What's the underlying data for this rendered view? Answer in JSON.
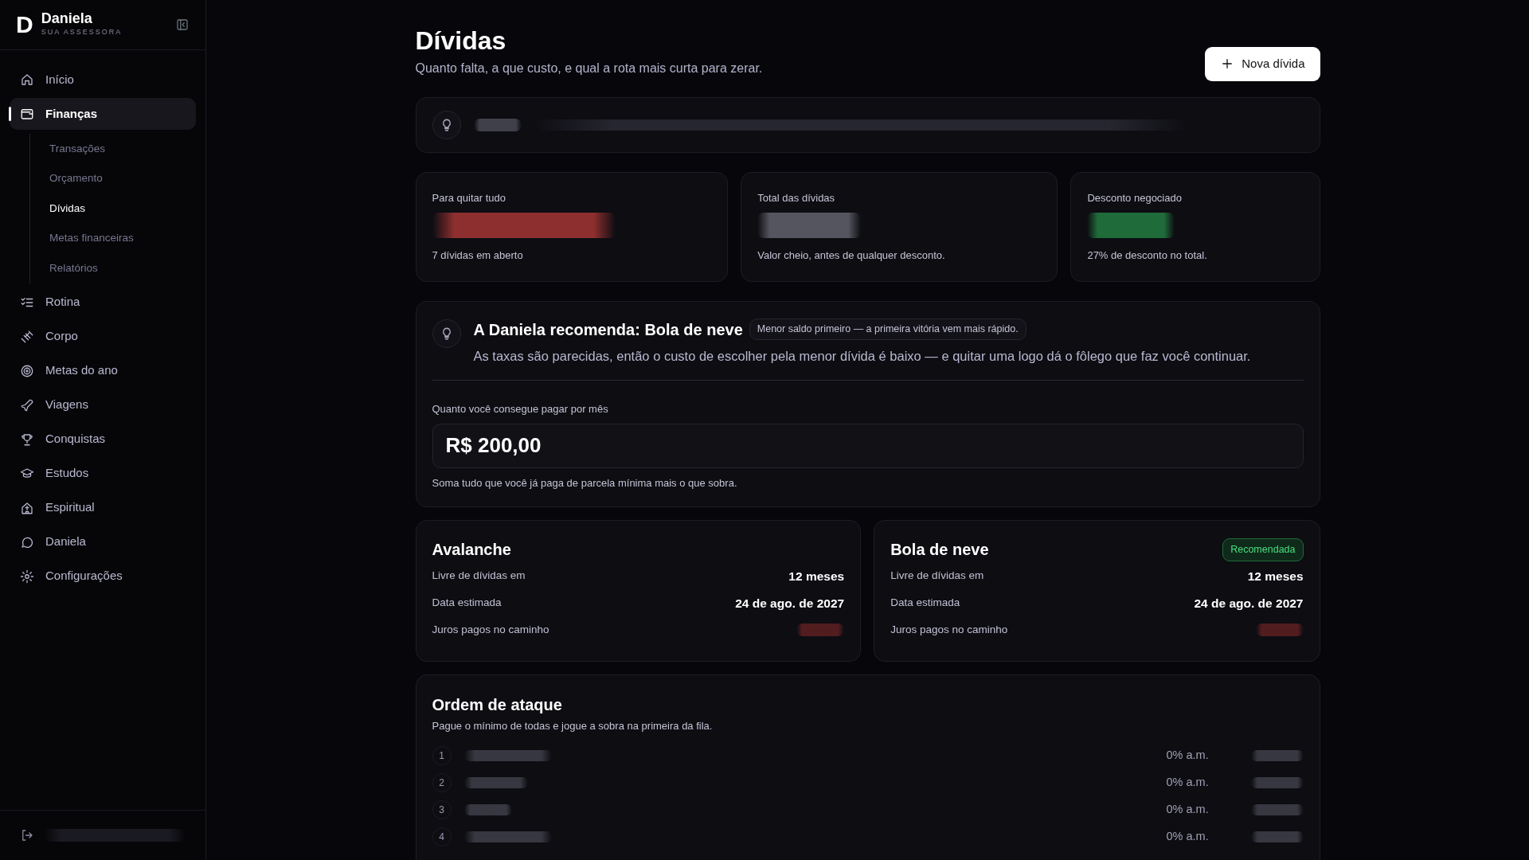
{
  "sidebar": {
    "brand": {
      "logo": "D",
      "name": "Daniela",
      "subtitle": "SUA ASSESSORA"
    },
    "items": [
      {
        "label": "Início",
        "selected": false
      },
      {
        "label": "Finanças",
        "selected": true,
        "children": [
          {
            "label": "Transações",
            "selected": false
          },
          {
            "label": "Orçamento",
            "selected": false
          },
          {
            "label": "Dívidas",
            "selected": true
          },
          {
            "label": "Metas financeiras",
            "selected": false
          },
          {
            "label": "Relatórios",
            "selected": false
          }
        ]
      },
      {
        "label": "Rotina",
        "selected": false
      },
      {
        "label": "Corpo",
        "selected": false
      },
      {
        "label": "Metas do ano",
        "selected": false
      },
      {
        "label": "Viagens",
        "selected": false
      },
      {
        "label": "Conquistas",
        "selected": false
      },
      {
        "label": "Estudos",
        "selected": false
      },
      {
        "label": "Espiritual",
        "selected": false
      },
      {
        "label": "Daniela",
        "selected": false
      },
      {
        "label": "Configurações",
        "selected": false
      }
    ]
  },
  "header": {
    "title": "Dívidas",
    "subtitle": "Quanto falta, a que custo, e qual a rota mais curta para zerar.",
    "button": "Nova dívida"
  },
  "summary": [
    {
      "label": "Para quitar tudo",
      "color": "#8e2f2f",
      "note": "7 dívidas em aberto"
    },
    {
      "label": "Total das dívidas",
      "color": "#55555f",
      "note": "Valor cheio, antes de qualquer desconto."
    },
    {
      "label": "Desconto negociado",
      "color": "#1f6b3a",
      "note": "27% de desconto no total."
    }
  ],
  "recommendation": {
    "title": "A Daniela recomenda: Bola de neve",
    "tag": "Menor saldo primeiro — a primeira vitória vem mais rápido.",
    "text": "As taxas são parecidas, então o custo de escolher pela menor dívida é baixo — e quitar uma logo dá o fôlego que faz você continuar.",
    "input_label": "Quanto você consegue pagar por mês",
    "value": "R$ 200,00",
    "hint": "Soma tudo que você já paga de parcela mínima mais o que sobra."
  },
  "strategies": [
    {
      "name": "Avalanche",
      "rows": [
        {
          "label": "Livre de dívidas em",
          "kind": "text",
          "value": "12 meses"
        },
        {
          "label": "Data estimada",
          "kind": "text",
          "value": "24 de ago. de 2027"
        },
        {
          "label": "Juros pagos no caminho",
          "kind": "hidden"
        }
      ]
    },
    {
      "name": "Bola de neve",
      "badge": "Recomendada",
      "rows": [
        {
          "label": "Livre de dívidas em",
          "kind": "text",
          "value": "12 meses"
        },
        {
          "label": "Data estimada",
          "kind": "text",
          "value": "24 de ago. de 2027"
        },
        {
          "label": "Juros pagos no caminho",
          "kind": "hidden"
        }
      ]
    }
  ],
  "order": {
    "title": "Ordem de ataque",
    "subtitle": "Pague o mínimo de todas e jogue a sobra na primeira da fila.",
    "rows": [
      {
        "number": "1",
        "rate": "0% a.m."
      },
      {
        "number": "2",
        "rate": "0% a.m."
      },
      {
        "number": "3",
        "rate": "0% a.m."
      },
      {
        "number": "4",
        "rate": "0% a.m."
      }
    ]
  }
}
